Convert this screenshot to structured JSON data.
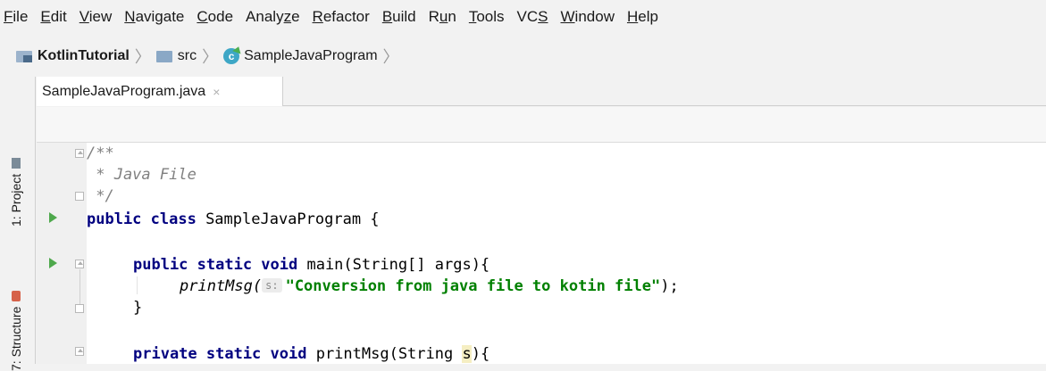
{
  "menu": {
    "items": [
      {
        "pre": "",
        "u": "F",
        "post": "ile"
      },
      {
        "pre": "",
        "u": "E",
        "post": "dit"
      },
      {
        "pre": "",
        "u": "V",
        "post": "iew"
      },
      {
        "pre": "",
        "u": "N",
        "post": "avigate"
      },
      {
        "pre": "",
        "u": "C",
        "post": "ode"
      },
      {
        "pre": "Analy",
        "u": "z",
        "post": "e"
      },
      {
        "pre": "",
        "u": "R",
        "post": "efactor"
      },
      {
        "pre": "",
        "u": "B",
        "post": "uild"
      },
      {
        "pre": "R",
        "u": "u",
        "post": "n"
      },
      {
        "pre": "",
        "u": "T",
        "post": "ools"
      },
      {
        "pre": "VC",
        "u": "S",
        "post": ""
      },
      {
        "pre": "",
        "u": "W",
        "post": "indow"
      },
      {
        "pre": "",
        "u": "H",
        "post": "elp"
      }
    ]
  },
  "breadcrumb": {
    "project": "KotlinTutorial",
    "folder": "src",
    "file": "SampleJavaProgram",
    "class_icon_letter": "c"
  },
  "toolwindows": {
    "project": "1: Project",
    "structure": "7: Structure"
  },
  "tab": {
    "title": "SampleJavaProgram.java",
    "close": "×"
  },
  "code": {
    "line1": "/**",
    "line2": " * Java File",
    "line3": " */",
    "line4_kw": "public class",
    "line4_rest": " SampleJavaProgram {",
    "line6_kw": "public static void",
    "line6_rest": " main(String[] args){",
    "line7_fn": "printMsg(",
    "line7_hint": "s:",
    "line7_str": "\"Conversion from java file to kotin file\"",
    "line7_end": ");",
    "line8": "}",
    "line10_kw": "private static void",
    "line10_rest": " printMsg(String ",
    "line10_param": "s",
    "line10_end": "){"
  },
  "colors": {
    "keyword": "#000080",
    "string": "#008000",
    "comment": "#808080",
    "run_arrow": "#4ea84c"
  }
}
